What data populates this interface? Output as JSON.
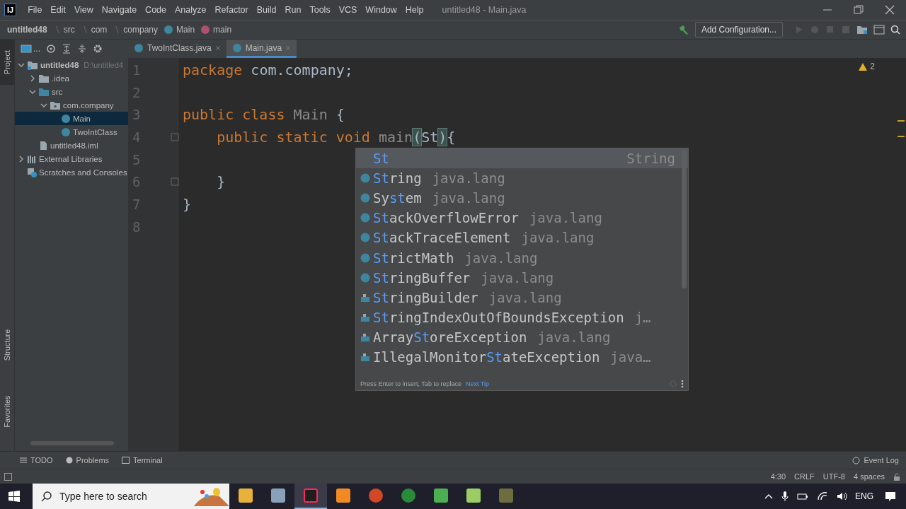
{
  "logo_text": "IJ",
  "menu_items": [
    "File",
    "Edit",
    "View",
    "Navigate",
    "Code",
    "Analyze",
    "Refactor",
    "Build",
    "Run",
    "Tools",
    "VCS",
    "Window",
    "Help"
  ],
  "window_title": "untitled48 - Main.java",
  "breadcrumbs": [
    {
      "label": "untitled48",
      "kind": "project"
    },
    {
      "label": "src",
      "kind": "dir"
    },
    {
      "label": "com",
      "kind": "dir"
    },
    {
      "label": "company",
      "kind": "dir"
    },
    {
      "label": "Main",
      "kind": "class"
    },
    {
      "label": "main",
      "kind": "method"
    }
  ],
  "run_config": "Add Configuration...",
  "panel_view_label": "...",
  "editor_tabs": [
    {
      "label": "TwoIntClass.java",
      "selected": false
    },
    {
      "label": "Main.java",
      "selected": true
    }
  ],
  "left_strip_top": [
    "Project"
  ],
  "left_strip_bottom": [
    "Structure",
    "Favorites"
  ],
  "project_tree": [
    {
      "label": "untitled48",
      "path": "D:\\untitled4",
      "kind": "module",
      "expanded": true,
      "selected": false,
      "children": [
        {
          "label": ".idea",
          "kind": "folder",
          "expanded": false,
          "selected": false
        },
        {
          "label": "src",
          "kind": "source",
          "expanded": true,
          "selected": false,
          "children": [
            {
              "label": "com.company",
              "kind": "package",
              "expanded": true,
              "selected": false,
              "children": [
                {
                  "label": "Main",
                  "kind": "class",
                  "selected": true
                },
                {
                  "label": "TwoIntClass",
                  "kind": "class",
                  "selected": false
                }
              ]
            }
          ]
        },
        {
          "label": "untitled48.iml",
          "kind": "file",
          "selected": false
        }
      ]
    },
    {
      "label": "External Libraries",
      "kind": "libraries",
      "expanded": false,
      "selected": false
    },
    {
      "label": "Scratches and Consoles",
      "kind": "scratches",
      "selected": false
    }
  ],
  "code_lines": [
    {
      "number": "1",
      "tokens": [
        {
          "text": "package",
          "kind": "keyword"
        },
        {
          "text": " com.company;",
          "kind": "text"
        }
      ]
    },
    {
      "number": "2"
    },
    {
      "number": "3",
      "tokens": [
        {
          "text": "public class",
          "kind": "keyword"
        },
        {
          "text": " Main",
          "kind": "dim"
        },
        {
          "text": " {",
          "kind": "text"
        }
      ]
    },
    {
      "number": "4",
      "fold": true,
      "tokens": [
        {
          "text": "    public static void",
          "kind": "keyword"
        },
        {
          "text": " main",
          "kind": "dim"
        },
        {
          "text": "(",
          "kind": "brace"
        },
        {
          "text": "St",
          "kind": "text"
        },
        {
          "text": ")",
          "kind": "brace"
        },
        {
          "text": "{",
          "kind": "text"
        }
      ]
    },
    {
      "number": "5"
    },
    {
      "number": "6",
      "fold": true,
      "tokens": [
        {
          "text": "    }",
          "kind": "text"
        }
      ]
    },
    {
      "number": "7",
      "tokens": [
        {
          "text": "}",
          "kind": "text"
        }
      ]
    },
    {
      "number": "8"
    }
  ],
  "warnings": "2",
  "completion": {
    "items": [
      {
        "kind": "template",
        "selected": true,
        "parts": [
          {
            "text": "St",
            "match": true
          }
        ],
        "detail": "String"
      },
      {
        "kind": "class",
        "selected": false,
        "parts": [
          {
            "text": "St",
            "match": true
          },
          {
            "text": "ring",
            "match": false
          }
        ],
        "detail": "java.lang"
      },
      {
        "kind": "class",
        "selected": false,
        "parts": [
          {
            "text": "Sy",
            "match": false
          },
          {
            "text": "st",
            "match": true
          },
          {
            "text": "em",
            "match": false
          }
        ],
        "detail": "java.lang"
      },
      {
        "kind": "class",
        "selected": false,
        "parts": [
          {
            "text": "St",
            "match": true
          },
          {
            "text": "ackOverflowError",
            "match": false
          }
        ],
        "detail": "java.lang"
      },
      {
        "kind": "class",
        "selected": false,
        "parts": [
          {
            "text": "St",
            "match": true
          },
          {
            "text": "ackTraceElement",
            "match": false
          }
        ],
        "detail": "java.lang"
      },
      {
        "kind": "class",
        "selected": false,
        "parts": [
          {
            "text": "St",
            "match": true
          },
          {
            "text": "rictMath",
            "match": false
          }
        ],
        "detail": "java.lang"
      },
      {
        "kind": "class",
        "selected": false,
        "parts": [
          {
            "text": "St",
            "match": true
          },
          {
            "text": "ringBuffer",
            "match": false
          }
        ],
        "detail": "java.lang"
      },
      {
        "kind": "library",
        "selected": false,
        "parts": [
          {
            "text": "St",
            "match": true
          },
          {
            "text": "ringBuilder",
            "match": false
          }
        ],
        "detail": "java.lang"
      },
      {
        "kind": "library",
        "selected": false,
        "parts": [
          {
            "text": "St",
            "match": true
          },
          {
            "text": "ringIndexOutOfBoundsException",
            "match": false
          }
        ],
        "detail": "j…"
      },
      {
        "kind": "library",
        "selected": false,
        "parts": [
          {
            "text": "Array",
            "match": false
          },
          {
            "text": "St",
            "match": true
          },
          {
            "text": "oreException",
            "match": false
          }
        ],
        "detail": "java.lang"
      },
      {
        "kind": "library",
        "selected": false,
        "parts": [
          {
            "text": "IllegalMonitor",
            "match": false
          },
          {
            "text": "St",
            "match": true
          },
          {
            "text": "ateException",
            "match": false
          }
        ],
        "detail": "java…"
      }
    ],
    "hint": "Press Enter to insert, Tab to replace",
    "tip_link": "Next Tip"
  },
  "tool_tabs": [
    {
      "label": "TODO",
      "kind": "list"
    },
    {
      "label": "Problems",
      "kind": "problems"
    },
    {
      "label": "Terminal",
      "kind": "terminal"
    }
  ],
  "event_log": "Event Log",
  "status_items": [
    "4:30",
    "CRLF",
    "UTF-8",
    "4 spaces"
  ],
  "taskbar": {
    "search_placeholder": "Type here to search",
    "apps": [
      {
        "kind": "folder",
        "selected": false
      },
      {
        "kind": "network",
        "selected": false
      },
      {
        "kind": "ide",
        "selected": true
      },
      {
        "kind": "pdf",
        "selected": false
      },
      {
        "kind": "slides",
        "selected": false
      },
      {
        "kind": "browser",
        "selected": false
      },
      {
        "kind": "notes",
        "selected": false
      },
      {
        "kind": "sheet",
        "selected": false
      },
      {
        "kind": "tool",
        "selected": false
      }
    ],
    "language": "ENG"
  }
}
